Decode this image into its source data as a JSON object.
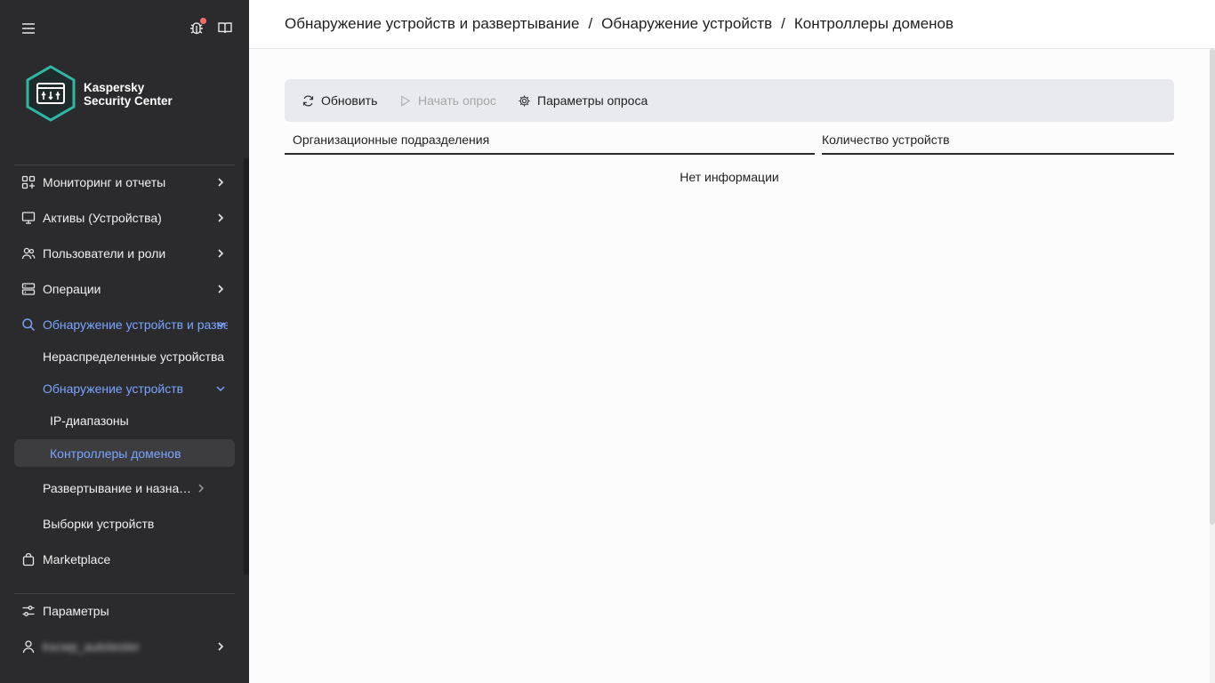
{
  "app": {
    "brand_line1": "Kaspersky",
    "brand_line2": "Security Center"
  },
  "colors": {
    "sidebar_bg": "#2b2b2d",
    "accent": "#7aa5ff",
    "hex_accent": "#2fb7a4",
    "notification": "#ff6b6b"
  },
  "sidebar": {
    "items": [
      {
        "label": "Мониторинг и отчеты",
        "icon": "dashboard-icon"
      },
      {
        "label": "Активы (Устройства)",
        "icon": "monitor-icon"
      },
      {
        "label": "Пользователи и роли",
        "icon": "users-icon"
      },
      {
        "label": "Операции",
        "icon": "server-icon"
      },
      {
        "label": "Обнаружение устройств и развертывание",
        "icon": "search-icon"
      },
      {
        "label": "Нераспределенные устройства"
      },
      {
        "label": "Обнаружение устройств"
      },
      {
        "label": "IP-диапазоны"
      },
      {
        "label": "Контроллеры доменов"
      },
      {
        "label": "Развертывание и назначение"
      },
      {
        "label": "Выборки устройств"
      },
      {
        "label": "Marketplace",
        "icon": "bag-icon"
      }
    ],
    "settings_label": "Параметры",
    "user_label": "kscwp_autotester"
  },
  "breadcrumb": {
    "level1": "Обнаружение устройств и развертывание",
    "level2": "Обнаружение устройств",
    "level3": "Контроллеры доменов",
    "separator": "/"
  },
  "toolbar": {
    "refresh": "Обновить",
    "start_poll": "Начать опрос",
    "poll_settings": "Параметры опроса"
  },
  "table": {
    "columns": [
      "Организационные подразделения",
      "Количество устройств"
    ],
    "empty": "Нет информации"
  }
}
